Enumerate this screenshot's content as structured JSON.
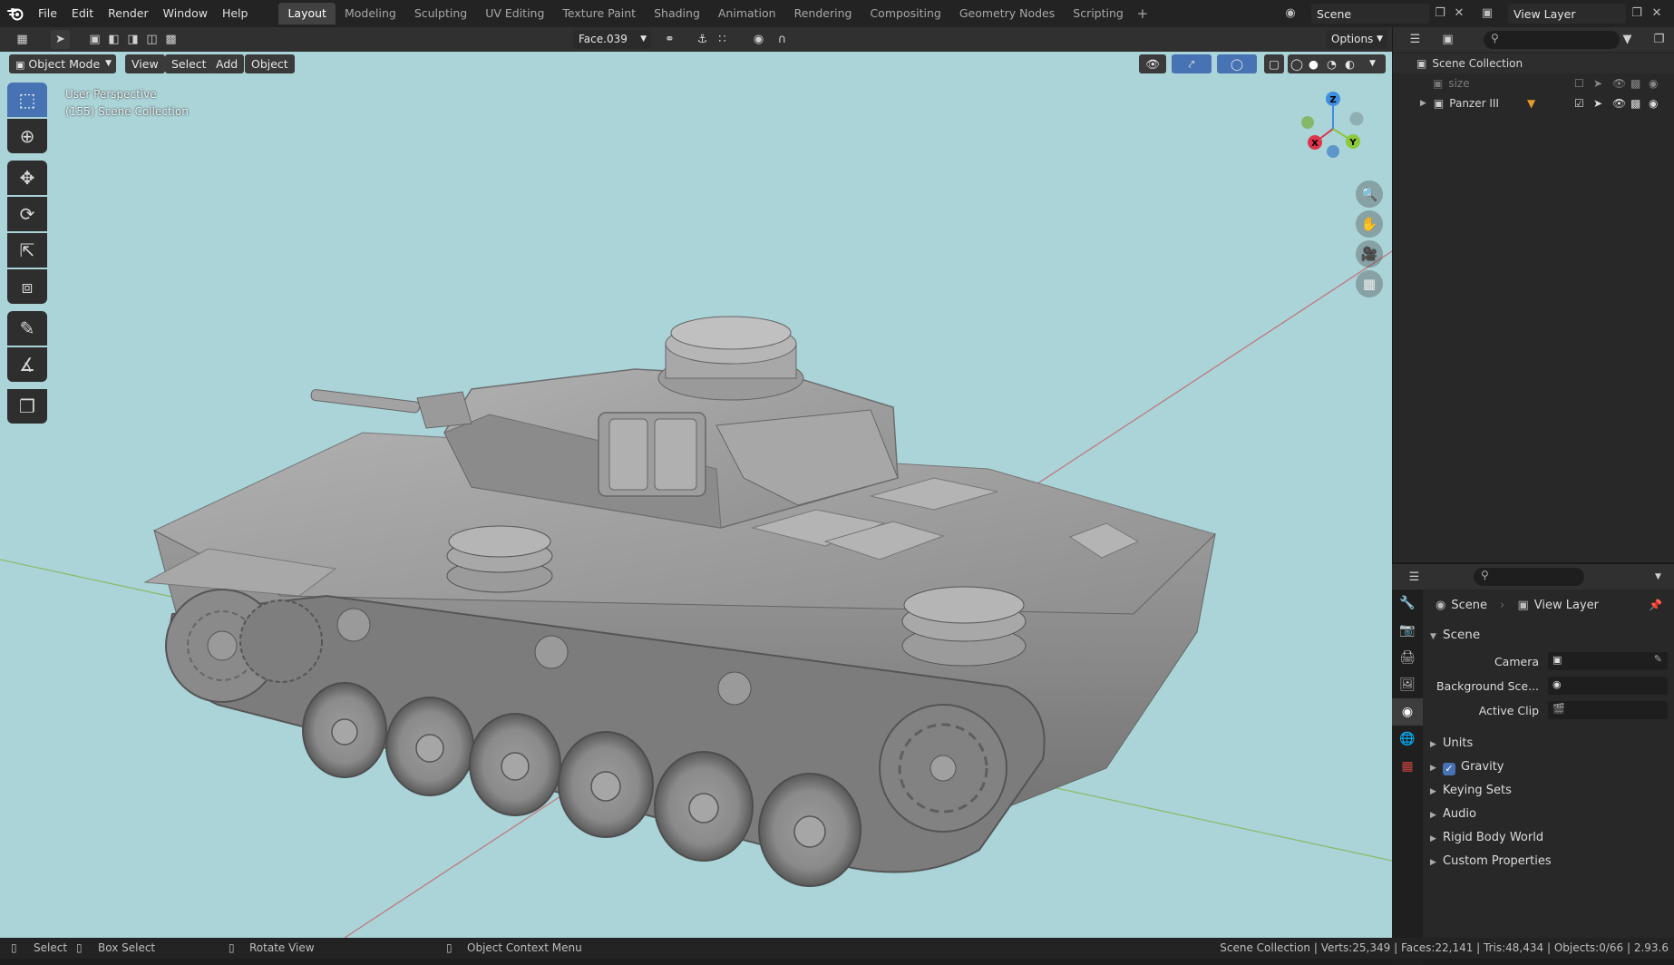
{
  "menus": [
    "File",
    "Edit",
    "Render",
    "Window",
    "Help"
  ],
  "workspaces": [
    "Layout",
    "Modeling",
    "Sculpting",
    "UV Editing",
    "Texture Paint",
    "Shading",
    "Animation",
    "Rendering",
    "Compositing",
    "Geometry Nodes",
    "Scripting"
  ],
  "active_workspace": "Layout",
  "add_workspace": "+",
  "scene_name": "Scene",
  "view_layer_name": "View Layer",
  "header": {
    "snap_target": "Face.039",
    "options_label": "Options"
  },
  "viewport": {
    "mode": "Object Mode",
    "menus": [
      "View",
      "Select",
      "Add",
      "Object"
    ],
    "perspective": "User Perspective",
    "collection_info": "(155) Scene Collection",
    "gizmo": {
      "x": "X",
      "y": "Y",
      "z": "Z"
    },
    "tools": [
      "select-box-icon",
      "cursor-icon",
      "move-icon",
      "rotate-icon",
      "scale-icon",
      "transform-icon",
      "annotate-icon",
      "measure-icon",
      "add-cube-icon"
    ]
  },
  "outliner": {
    "root": "Scene Collection",
    "items": [
      {
        "name": "size",
        "dimmed": true
      },
      {
        "name": "Panzer III",
        "dimmed": false
      }
    ]
  },
  "properties": {
    "breadcrumb_scene": "Scene",
    "breadcrumb_layer": "View Layer",
    "panel_title": "Scene",
    "fields": [
      {
        "label": "Camera"
      },
      {
        "label": "Background Sce..."
      },
      {
        "label": "Active Clip"
      }
    ],
    "sections": [
      "Units",
      "Gravity",
      "Keying Sets",
      "Audio",
      "Rigid Body World",
      "Custom Properties"
    ],
    "gravity_checked": true
  },
  "status": {
    "select": "Select",
    "box_select": "Box Select",
    "rotate": "Rotate View",
    "context": "Object Context Menu",
    "stats": "Scene Collection | Verts:25,349 | Faces:22,141 | Tris:48,434 | Objects:0/66 | 2.93.6"
  },
  "colors": {
    "viewport_bg": "#aad4d8",
    "accent": "#4772b3",
    "axis_x": "#e0334c",
    "axis_y": "#8bc83c",
    "axis_z": "#3f8fe0"
  }
}
